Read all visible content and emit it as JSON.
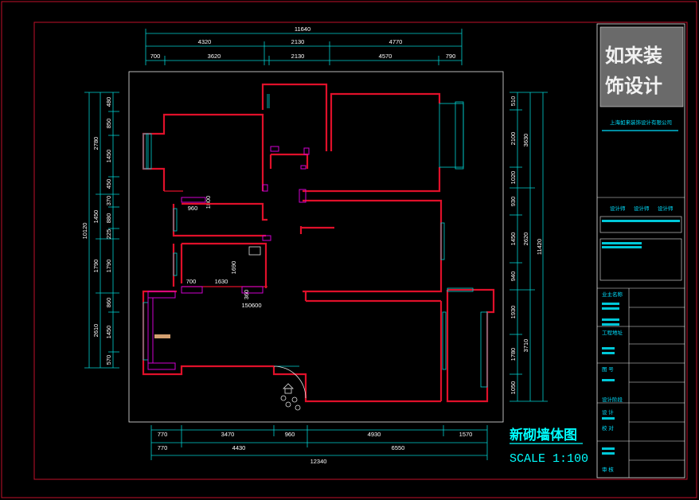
{
  "drawing": {
    "title": "新砌墙体图",
    "scale": "SCALE 1:100"
  },
  "dimensions": {
    "top_total": "11640",
    "top_row1": [
      "4320",
      "2130",
      "4770"
    ],
    "top_row2": [
      "700",
      "3620",
      "2130",
      "4570",
      "790"
    ],
    "bottom_row1": [
      "770",
      "3470",
      "960",
      "4930",
      "1570"
    ],
    "bottom_row2": [
      "770",
      "4430",
      "6550"
    ],
    "bottom_total": "12340",
    "left_total": "10120",
    "left_row1": [
      "2780",
      "1450",
      "1790",
      "2610"
    ],
    "left_row2": [
      "480",
      "850",
      "1450",
      "450",
      "370",
      "880",
      "225",
      "1790",
      "860",
      "1450",
      "570"
    ],
    "right_total": "11420",
    "right_row1": [
      "3630",
      "2620",
      "3710"
    ],
    "right_row2": [
      "510",
      "2100",
      "1020",
      "930",
      "1450",
      "940",
      "1930",
      "1780",
      "1050"
    ],
    "interior": [
      "960",
      "700",
      "1630",
      "1690",
      "360",
      "150600",
      "1800"
    ]
  },
  "title_block": {
    "logo_line1": "如来装",
    "logo_line2": "饰设计",
    "company": "上海如来装饰设计有限公司",
    "designers": [
      "设计师",
      "设计师",
      "设计师"
    ],
    "fields": [
      {
        "label": "业主名称"
      },
      {
        "label": "工程地址"
      },
      {
        "label": "图 号"
      },
      {
        "label": "设计阶段"
      },
      {
        "label": "设 计"
      },
      {
        "label": "校 对"
      },
      {
        "label": "审 核"
      }
    ]
  },
  "colors": {
    "wall": "#e0102a",
    "dimension": "#00d0d0",
    "frame": "#c0102a",
    "fixture": "#d000d0",
    "text": "#ffffff"
  }
}
